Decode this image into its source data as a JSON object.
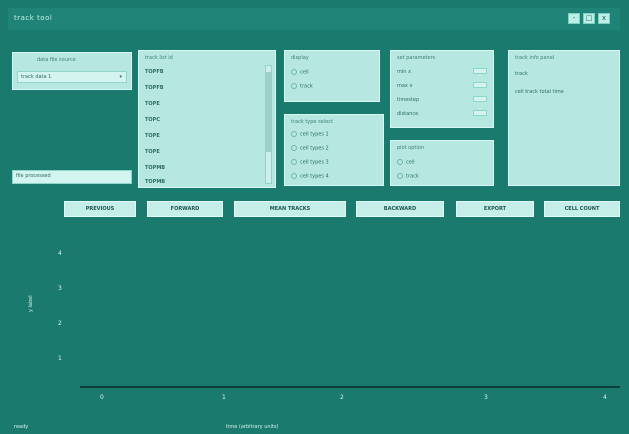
{
  "window": {
    "title": "track tool",
    "controls": [
      "-",
      "□",
      "x"
    ]
  },
  "panels": {
    "source": {
      "label": "data file source",
      "select_value": "track data 1",
      "bottom_field": "file processed"
    },
    "tracks": {
      "label": "track list  id",
      "items": [
        "TOPFB",
        "TOPFB",
        "TOPE",
        "TOPC",
        "TOPE",
        "TOPE",
        "TOPMB",
        "TOPMB"
      ]
    },
    "display": {
      "label": "display",
      "options": [
        "cell",
        "track"
      ]
    },
    "type": {
      "label": "track type select",
      "options": [
        "cell types 1",
        "cell types 2",
        "cell types 3",
        "cell types 4"
      ]
    },
    "params": {
      "label": "set parameters",
      "rows": [
        "min x",
        "max x",
        "timestep",
        "distance"
      ]
    },
    "mode": {
      "label": "plot option",
      "options": [
        "cell",
        "track"
      ]
    },
    "info": {
      "label": "track info panel",
      "lines": [
        "track",
        "cell  track  total time"
      ]
    }
  },
  "toolbar": {
    "buttons": [
      "PREVIOUS",
      "FORWARD",
      "MEAN TRACKS",
      "BACKWARD",
      "EXPORT",
      "CELL COUNT"
    ]
  },
  "plot": {
    "y_ticks": [
      "4",
      "3",
      "2",
      "1"
    ],
    "x_ticks": [
      "0",
      "1",
      "2",
      "3",
      "4"
    ],
    "ylabel": "y label",
    "xlabel": "time (arbitrary units)",
    "status": "ready"
  }
}
